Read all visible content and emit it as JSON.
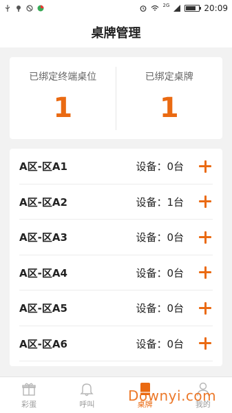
{
  "status_bar": {
    "time": "20:09",
    "network": "2G",
    "colors": {
      "background": "#ffffff",
      "text": "#333333"
    }
  },
  "header": {
    "title": "桌牌管理"
  },
  "summary": {
    "left": {
      "label": "已绑定终端桌位",
      "value": "1"
    },
    "right": {
      "label": "已绑定桌牌",
      "value": "1"
    }
  },
  "zones": [
    {
      "name": "A区-区A1",
      "device": "设备：0台"
    },
    {
      "name": "A区-区A2",
      "device": "设备：1台"
    },
    {
      "name": "A区-区A3",
      "device": "设备：0台"
    },
    {
      "name": "A区-区A4",
      "device": "设备：0台"
    },
    {
      "name": "A区-区A5",
      "device": "设备：0台"
    },
    {
      "name": "A区-区A6",
      "device": "设备：0台"
    }
  ],
  "tabbar": {
    "tabs": [
      {
        "label": "彩蛋",
        "icon": "gift-icon"
      },
      {
        "label": "呼叫",
        "icon": "bell-icon"
      },
      {
        "label": "桌牌",
        "icon": "table-card-icon",
        "active": true
      },
      {
        "label": "我的",
        "icon": "user-icon"
      }
    ]
  },
  "watermark": "Downyi.com",
  "colors": {
    "accent": "#ea6a12",
    "background": "#f2f2f2",
    "card": "#ffffff"
  }
}
